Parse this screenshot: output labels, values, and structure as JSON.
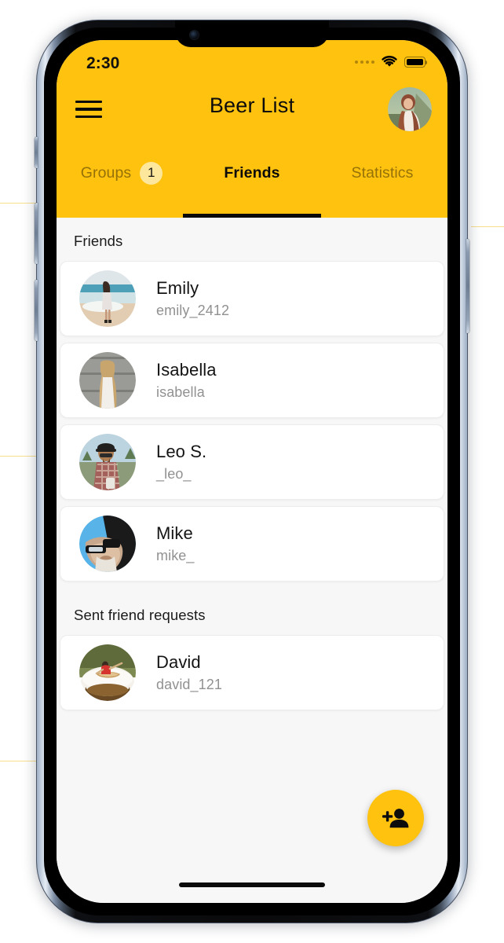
{
  "status_bar": {
    "time": "2:30",
    "cellular_icon": "signal-dots-icon",
    "wifi_icon": "wifi-icon",
    "battery_icon": "battery-full-icon",
    "battery_level_pct": 100
  },
  "app_bar": {
    "menu_icon": "hamburger-menu-icon",
    "title": "Beer List",
    "avatar_icon": "user-avatar",
    "background_color": "#ffc20e",
    "text_color": "#0c0c0c"
  },
  "tabs": [
    {
      "label": "Groups",
      "badge": "1",
      "active": false
    },
    {
      "label": "Friends",
      "badge": "",
      "active": true
    },
    {
      "label": "Statistics",
      "badge": "",
      "active": false
    }
  ],
  "sections": [
    {
      "heading": "Friends",
      "items": [
        {
          "name": "Emily",
          "username": "emily_2412",
          "avatar_icon": "avatar-emily"
        },
        {
          "name": "Isabella",
          "username": "isabella",
          "avatar_icon": "avatar-isabella"
        },
        {
          "name": "Leo S.",
          "username": "_leo_",
          "avatar_icon": "avatar-leo"
        },
        {
          "name": "Mike",
          "username": "mike_",
          "avatar_icon": "avatar-mike"
        }
      ]
    },
    {
      "heading": "Sent friend requests",
      "items": [
        {
          "name": "David",
          "username": "david_121",
          "avatar_icon": "avatar-david"
        }
      ]
    }
  ],
  "fab": {
    "icon": "add-person-icon",
    "background_color": "#ffc20e"
  },
  "theme": {
    "accent": "#ffc20e",
    "badge_bg": "#fde79c",
    "page_bg": "#f7f7f7",
    "card_bg": "#ffffff",
    "primary_text": "#141414",
    "secondary_text": "#919191"
  }
}
